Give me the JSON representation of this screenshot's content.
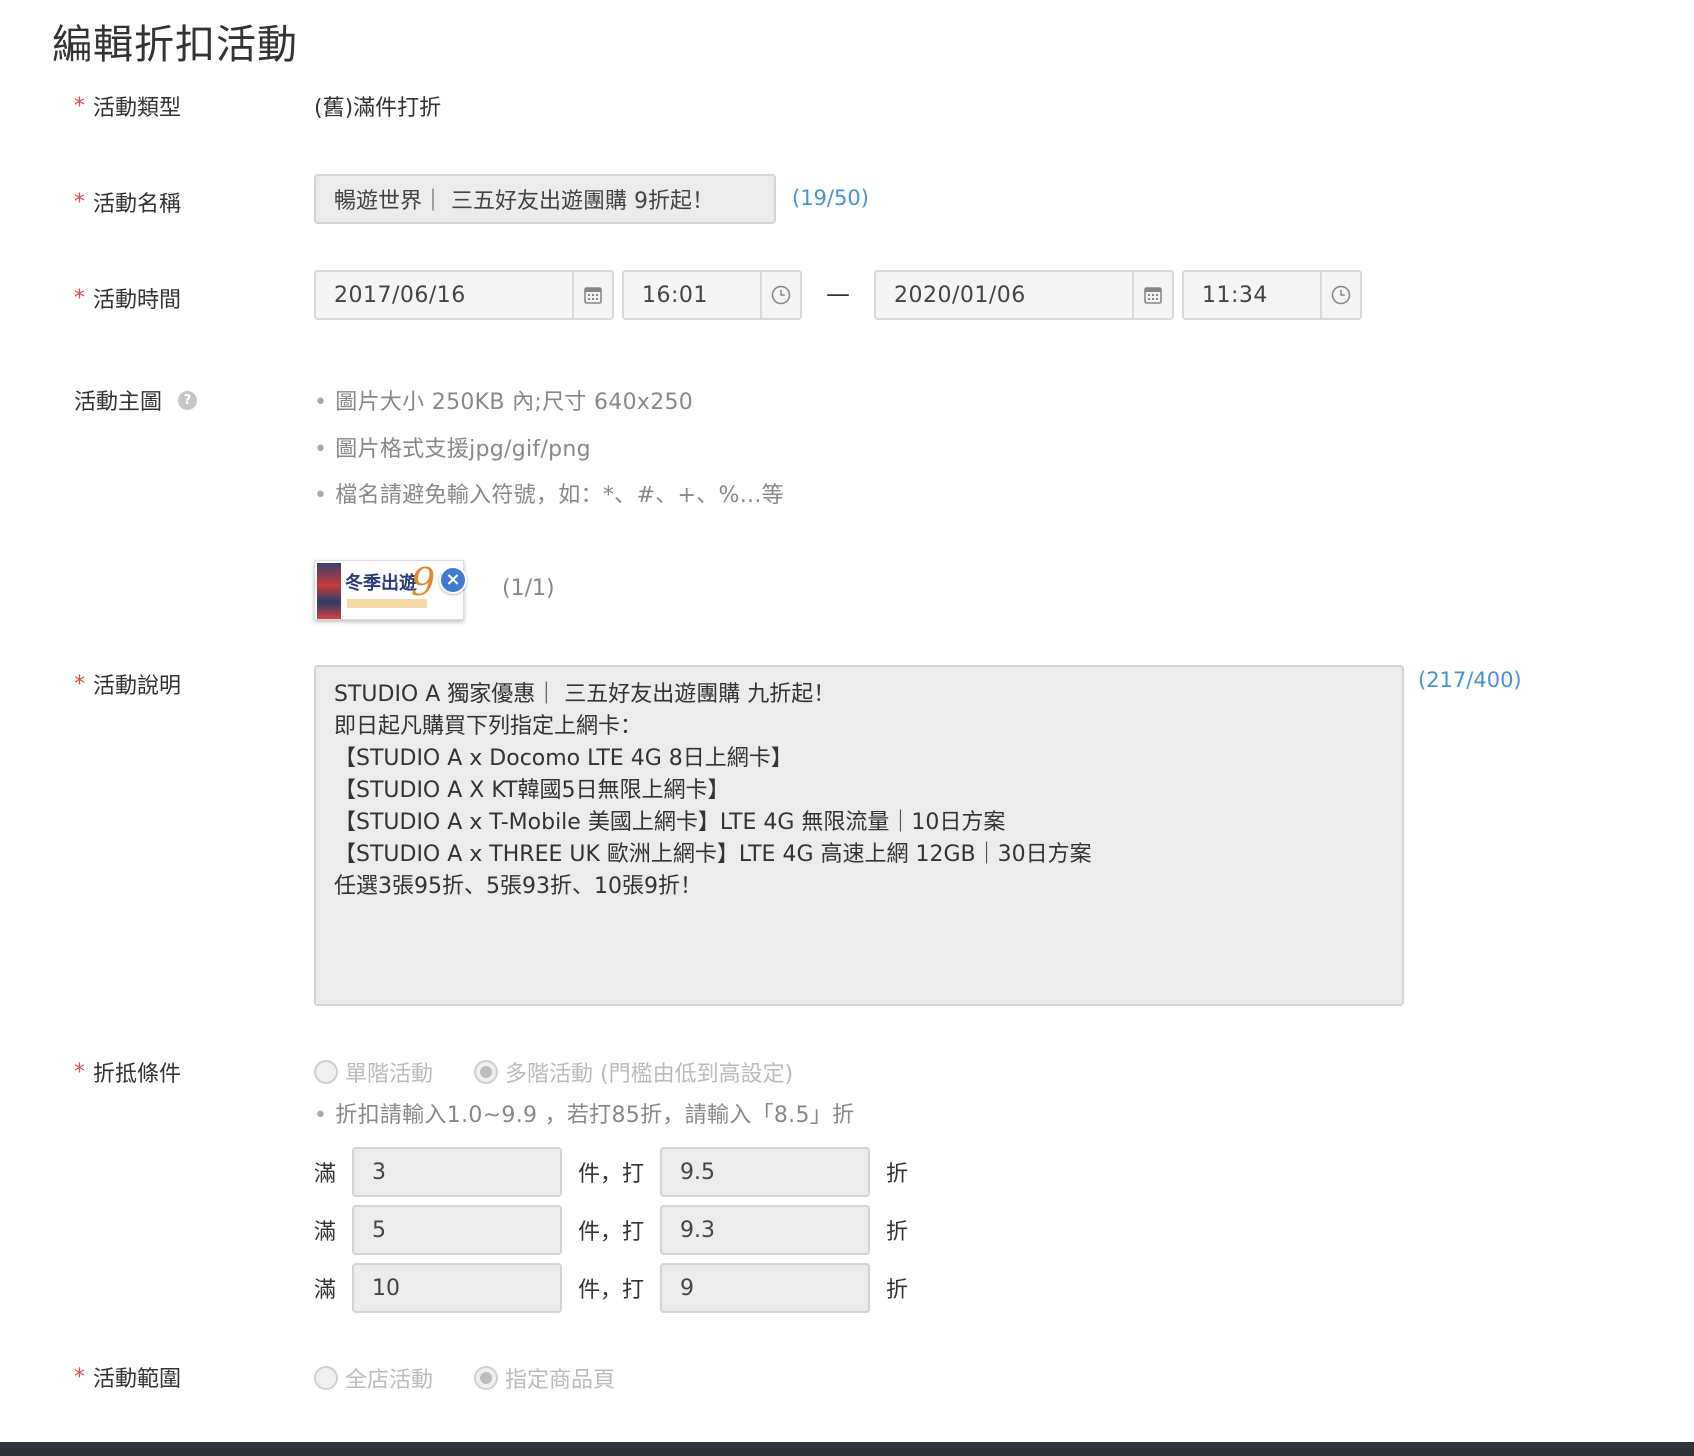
{
  "page_title": "編輯折扣活動",
  "fields": {
    "type_label": "活動類型",
    "type_value": "(舊)滿件打折",
    "name_label": "活動名稱",
    "name_value": "暢遊世界｜ 三五好友出遊團購 9折起！",
    "name_counter": "(19/50)",
    "time_label": "活動時間",
    "start_date": "2017/06/16",
    "start_time": "16:01",
    "dash": "—",
    "end_date": "2020/01/06",
    "end_time": "11:34",
    "image_label": "活動主圖",
    "image_help_icon": "?",
    "image_notes": [
      "圖片大小 250KB 內;尺寸 640x250",
      "圖片格式支援jpg/gif/png",
      "檔名請避免輸入符號，如：*、#、+、%...等"
    ],
    "image_thumb_title": "冬季出遊",
    "image_thumb_nine": "9",
    "image_remove_glyph": "×",
    "image_count": "(1/1)",
    "desc_label": "活動說明",
    "desc_lines": [
      "STUDIO A 獨家優惠｜ 三五好友出遊團購 九折起！",
      "即日起凡購買下列指定上網卡：",
      "【STUDIO A x Docomo LTE 4G 8日上網卡】",
      "【STUDIO A X KT韓國5日無限上網卡】",
      "【STUDIO A x T-Mobile 美國上網卡】LTE 4G 無限流量｜10日方案",
      "【STUDIO A x THREE UK 歐洲上網卡】LTE 4G 高速上網 12GB｜30日方案",
      "任選3張95折、5張93折、10張9折！"
    ],
    "desc_counter": "(217/400)",
    "condition_label": "折抵條件",
    "condition_options": [
      "單階活動",
      "多階活動 (門檻由低到高設定)"
    ],
    "condition_selected": 1,
    "condition_note": "折扣請輸入1.0~9.9 ，若打85折，請輸入「8.5」折",
    "tier_prefix": "滿",
    "tier_middle": "件，打",
    "tier_suffix": "折",
    "tiers": [
      {
        "qty": "3",
        "discount": "9.5"
      },
      {
        "qty": "5",
        "discount": "9.3"
      },
      {
        "qty": "10",
        "discount": "9"
      }
    ],
    "scope_label": "活動範圍",
    "scope_options": [
      "全店活動",
      "指定商品頁"
    ],
    "scope_selected": 1,
    "required_mark": "*"
  },
  "icons": {
    "calendar": "calendar-icon",
    "clock": "clock-icon",
    "help": "question-circle-icon",
    "remove": "close-circle-icon"
  },
  "colors": {
    "required": "#e8494a",
    "counter": "#4a90d9",
    "footer": "#30343b",
    "remove_button": "#3f7bd1"
  }
}
